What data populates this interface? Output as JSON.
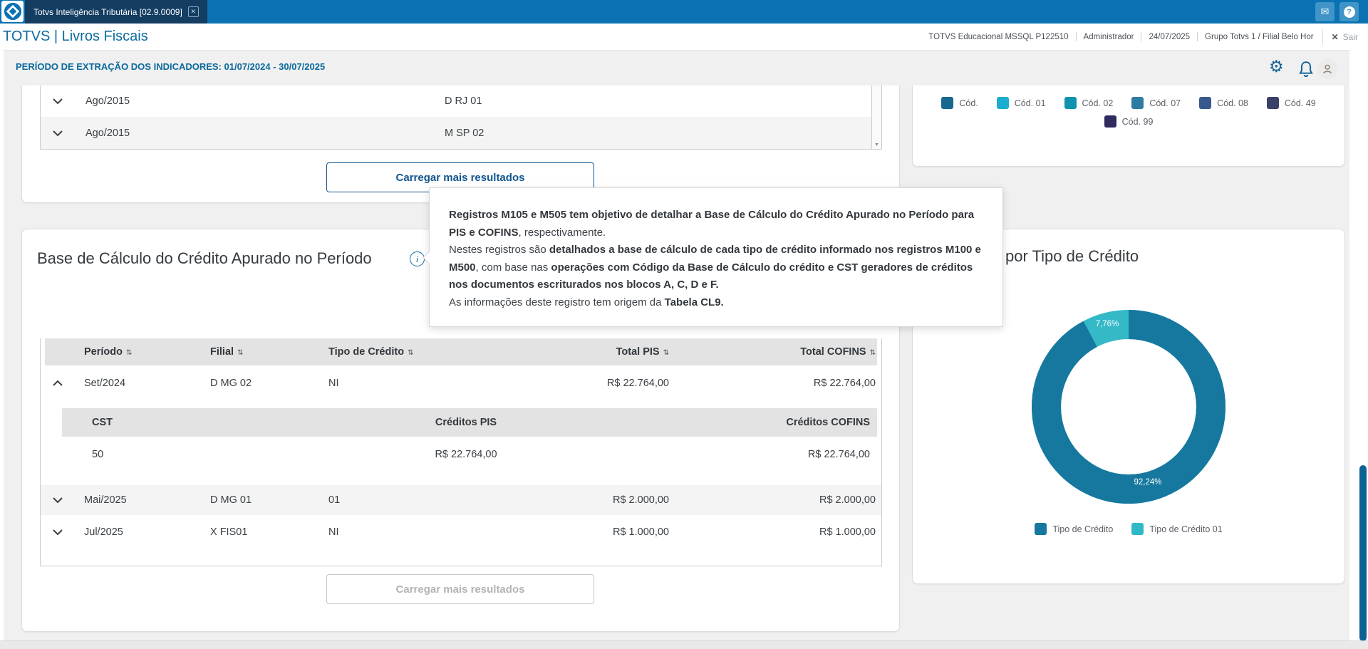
{
  "icons": {
    "close": "✕",
    "mail": "✉",
    "help": "?",
    "sort": "⇅",
    "gear": "⚙",
    "scroll_down_arrow": "▼",
    "info": "i",
    "logout_x": "✕"
  },
  "topbar": {
    "tab_title": "Totvs Inteligência Tributária [02.9.0009]"
  },
  "header": {
    "app_title": "TOTVS | Livros Fiscais",
    "environment": "TOTVS Educacional MSSQL P122510",
    "user": "Administrador",
    "date": "24/07/2025",
    "group": "Grupo Totvs 1 / Filial Belo Hor",
    "logout_label": "Sair"
  },
  "period": {
    "label": "PERÍODO DE EXTRAÇÃO DOS INDICADORES: 01/07/2024 - 30/07/2025"
  },
  "top_left_card": {
    "rows": [
      {
        "period": "Ago/2015",
        "code": "D RJ 01"
      },
      {
        "period": "Ago/2015",
        "code": "M SP 02"
      }
    ],
    "load_more": "Carregar mais resultados"
  },
  "top_right_card": {
    "legend": [
      {
        "label": "Cód.",
        "color": "#17678f"
      },
      {
        "label": "Cód. 01",
        "color": "#1badcd"
      },
      {
        "label": "Cód. 02",
        "color": "#0f93ae"
      },
      {
        "label": "Cód. 07",
        "color": "#2f7ca3"
      },
      {
        "label": "Cód. 08",
        "color": "#37598b"
      },
      {
        "label": "Cód. 49",
        "color": "#3a4167"
      },
      {
        "label": "Cód. 99",
        "color": "#2f2b5e"
      }
    ]
  },
  "tooltip": {
    "p1_bold": "Registros M105 e M505 tem objetivo de detalhar a Base de Cálculo do Crédito Apurado no Período para PIS e COFINS",
    "p1_normal": ", respectivamente.",
    "p2_n1": "Nestes registros são ",
    "p2_b1": "detalhados a base de cálculo de cada tipo de crédito informado nos registros M100 e M500",
    "p2_n2": ", com base nas ",
    "p2_b2": "operações com Código da Base de Cálculo do crédito e CST geradores de créditos nos documentos escriturados nos blocos A, C, D e F.",
    "p3_n1": "As informações deste registro tem origem da ",
    "p3_b1": "Tabela CL9."
  },
  "bottom_left_card": {
    "title": "Base de Cálculo do Crédito Apurado no Período",
    "table": {
      "columns": [
        "Período",
        "Filial",
        "Tipo de Crédito",
        "Total PIS",
        "Total COFINS"
      ],
      "rows": [
        {
          "period": "Set/2024",
          "filial": "D MG 02",
          "tipo": "NI",
          "pis": "R$ 22.764,00",
          "cofins": "R$ 22.764,00",
          "expanded": true
        },
        {
          "period": "Mai/2025",
          "filial": "D MG 01",
          "tipo": "01",
          "pis": "R$ 2.000,00",
          "cofins": "R$ 2.000,00",
          "expanded": false
        },
        {
          "period": "Jul/2025",
          "filial": "X FIS01",
          "tipo": "NI",
          "pis": "R$ 1.000,00",
          "cofins": "R$ 1.000,00",
          "expanded": false
        }
      ],
      "sub": {
        "columns": [
          "CST",
          "Créditos PIS",
          "Créditos COFINS"
        ],
        "rows": [
          {
            "cst": "50",
            "pis": "R$ 22.764,00",
            "cofins": "R$ 22.764,00"
          }
        ]
      }
    },
    "load_more": "Carregar mais resultados"
  },
  "bottom_right_card": {
    "title_visible": "por Tipo de Crédito",
    "legend": [
      {
        "label": "Tipo de Crédito",
        "color": "#16789f"
      },
      {
        "label": "Tipo de Crédito 01",
        "color": "#2fb9c7"
      }
    ]
  },
  "chart_data": [
    {
      "type": "pie",
      "donut": true,
      "title": "por Tipo de Crédito",
      "labels": [
        "Tipo de Crédito",
        "Tipo de Crédito 01"
      ],
      "values": [
        92.24,
        7.76
      ],
      "value_labels": [
        "92,24%",
        "7,76%"
      ],
      "colors": [
        "#16789f",
        "#34b9c7"
      ],
      "legend_position": "bottom"
    },
    {
      "type": "bar",
      "note": "only legend visible, plot scrolled out of view",
      "series_labels": [
        "Cód.",
        "Cód. 01",
        "Cód. 02",
        "Cód. 07",
        "Cód. 08",
        "Cód. 49",
        "Cód. 99"
      ]
    }
  ],
  "colors": {
    "topbar": "#0a72b2",
    "tab": "#143d62",
    "accent_blue": "#11568f",
    "title_blue": "#0c6d9e",
    "donut_primary": "#16789f",
    "donut_secondary": "#34b9c7"
  }
}
